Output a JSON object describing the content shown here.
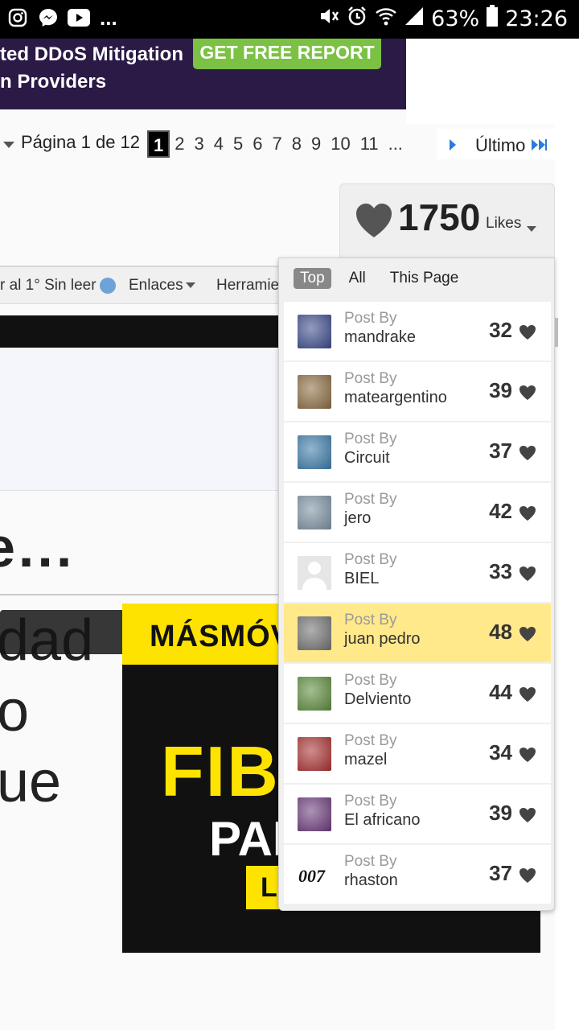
{
  "status_bar": {
    "battery": "63%",
    "time": "23:26",
    "more": "..."
  },
  "ad_banner": {
    "line1": "ted DDoS Mitigation",
    "line2": "n Providers",
    "button": "GET FREE REPORT"
  },
  "pagination": {
    "label": "Página 1 de 12",
    "pages": [
      "1",
      "2",
      "3",
      "4",
      "5",
      "6",
      "7",
      "8",
      "9",
      "10",
      "11",
      "..."
    ],
    "current": "1",
    "last_label": "Último"
  },
  "nav": {
    "item1": "r al 1° Sin leer",
    "item2": "Enlaces",
    "item3": "Herramie"
  },
  "likes": {
    "count": "1750",
    "label": "Likes",
    "tabs": [
      "Top",
      "All",
      "This Page"
    ],
    "active_tab": "Top",
    "post_by_label": "Post By",
    "entries": [
      {
        "user": "mandrake",
        "count": "32",
        "avatar": "figure-icon",
        "color": "#3a4a8a"
      },
      {
        "user": "mateargentino",
        "count": "39",
        "avatar": "mate-icon",
        "color": "#8a6a40"
      },
      {
        "user": "Circuit",
        "count": "37",
        "avatar": "skull-icon",
        "color": "#3a7aa8"
      },
      {
        "user": "jero",
        "count": "42",
        "avatar": "sailboat-icon",
        "color": "#7a8fa0"
      },
      {
        "user": "BIEL",
        "count": "33",
        "avatar": "default-avatar-icon",
        "color": "#e0e0e0"
      },
      {
        "user": "juan pedro",
        "count": "48",
        "avatar": "watch-icon",
        "color": "#707070"
      },
      {
        "user": "Delviento",
        "count": "44",
        "avatar": "palm-icon",
        "color": "#5a8a3a"
      },
      {
        "user": "mazel",
        "count": "34",
        "avatar": "santa-icon",
        "color": "#a83030"
      },
      {
        "user": "El africano",
        "count": "39",
        "avatar": "sunset-tree-icon",
        "color": "#6a3a7a"
      },
      {
        "user": "rhaston",
        "count": "37",
        "avatar": "007-logo-icon",
        "color": "#222222"
      }
    ],
    "highlight_user": "juan pedro",
    "highlight_color": "#ffe98b"
  },
  "article": {
    "heading_fragment": "e...",
    "lines": [
      "dad",
      "o",
      "ue"
    ]
  },
  "bottom_ad": {
    "brand": "MÁSMÓV",
    "headline": "FIBR",
    "sub": "PAR",
    "cta": "LA",
    "mark": "¡"
  }
}
